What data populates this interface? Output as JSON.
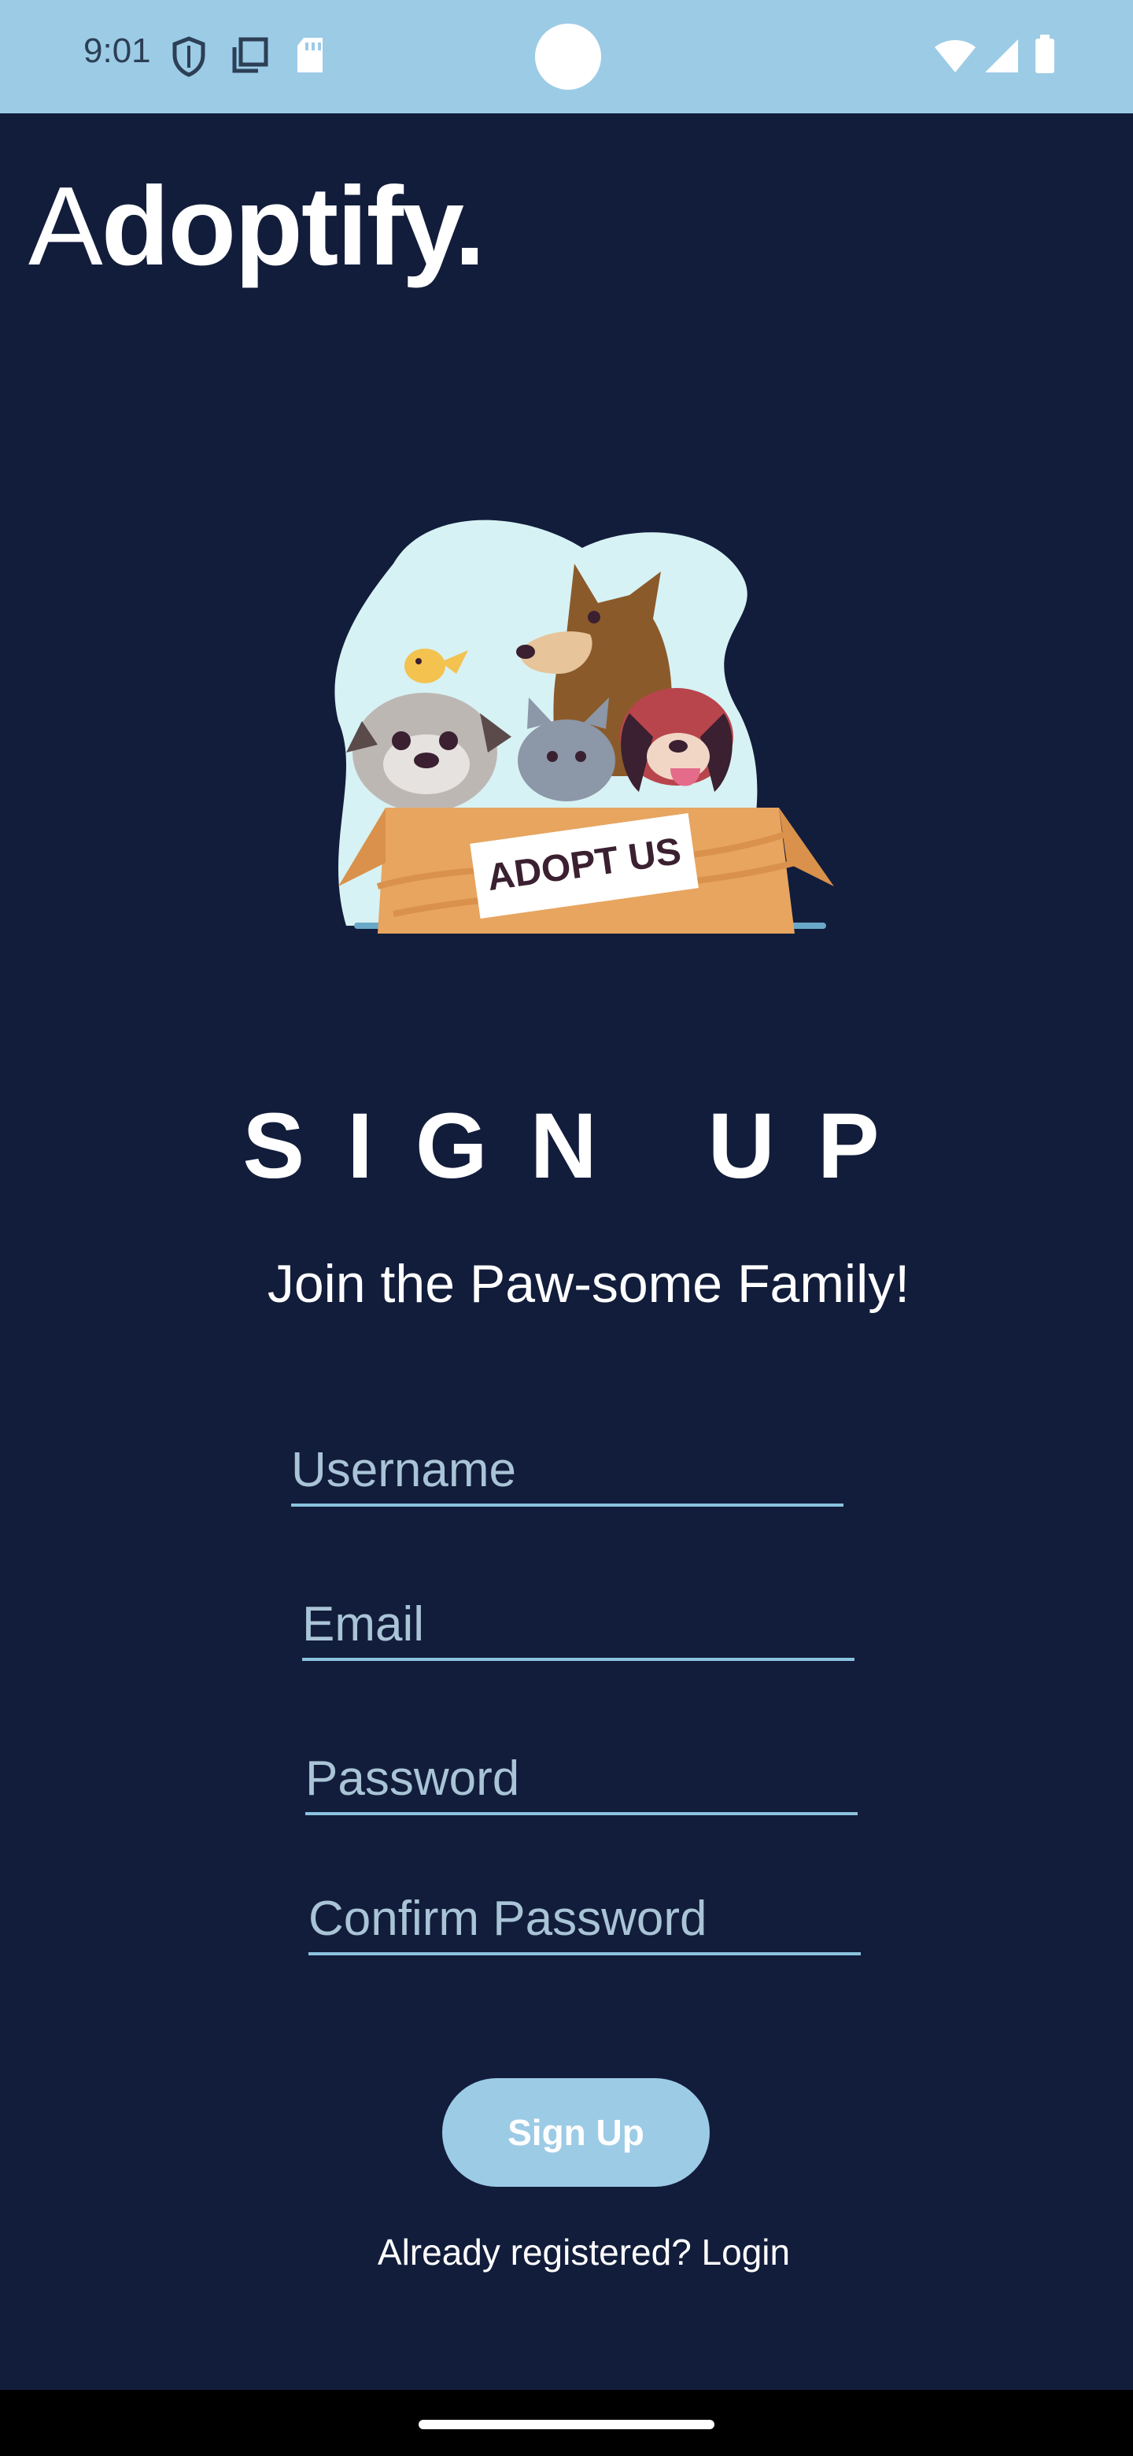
{
  "status_bar": {
    "time": "9:01",
    "left_icons": [
      "shield-icon",
      "copy-icon",
      "sd-card-icon"
    ],
    "right_icons": [
      "wifi-icon",
      "signal-icon",
      "battery-icon"
    ]
  },
  "app": {
    "brand_regular": "A",
    "brand_bold": "doptify.",
    "hero_sign_text": "ADOPT US",
    "title": "SIGN UP",
    "subtitle": "Join the Paw-some Family!"
  },
  "form": {
    "username": {
      "placeholder": "Username",
      "value": ""
    },
    "email": {
      "placeholder": "Email",
      "value": ""
    },
    "password": {
      "placeholder": "Password",
      "value": ""
    },
    "confirm_password": {
      "placeholder": "Confirm Password",
      "value": ""
    },
    "submit_label": "Sign Up",
    "login_link": "Already registered? Login"
  },
  "colors": {
    "background": "#121d3b",
    "accent": "#9ccbe6",
    "status_bar": "#9ccbe6"
  }
}
